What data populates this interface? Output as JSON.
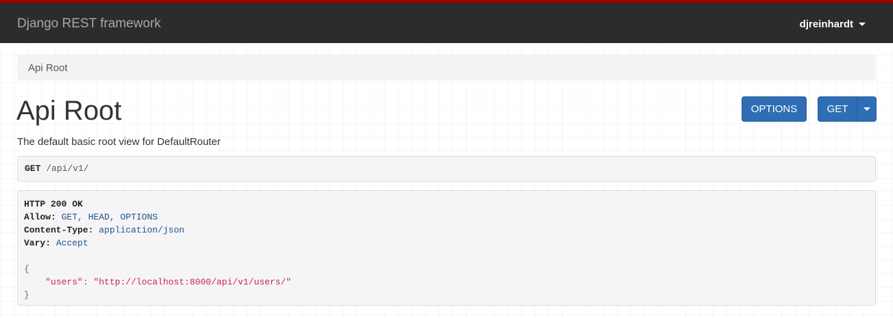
{
  "navbar": {
    "brand": "Django REST framework",
    "user": "djreinhardt"
  },
  "breadcrumb": {
    "item": "Api Root"
  },
  "page": {
    "title": "Api Root",
    "description": "The default basic root view for DefaultRouter"
  },
  "buttons": {
    "options": "OPTIONS",
    "get": "GET"
  },
  "request": {
    "method": "GET",
    "path": "/api/v1/"
  },
  "response": {
    "status": "HTTP 200 OK",
    "headers": [
      {
        "name": "Allow:",
        "value": "GET, HEAD, OPTIONS"
      },
      {
        "name": "Content-Type:",
        "value": "application/json"
      },
      {
        "name": "Vary:",
        "value": "Accept"
      }
    ],
    "body": {
      "open": "{",
      "key": "\"users\"",
      "colon": ": ",
      "value": "\"http://localhost:8000/api/v1/users/\"",
      "close": "}"
    }
  },
  "colors": {
    "accent_stripe": "#a30000",
    "navbar_bg": "#2c2c2c",
    "button_bg": "#2f6db5",
    "json_string": "#c7254e",
    "header_value": "#1f4f8f"
  },
  "icons": {
    "user_menu": "caret-down-icon",
    "get_dropdown": "caret-down-icon"
  }
}
